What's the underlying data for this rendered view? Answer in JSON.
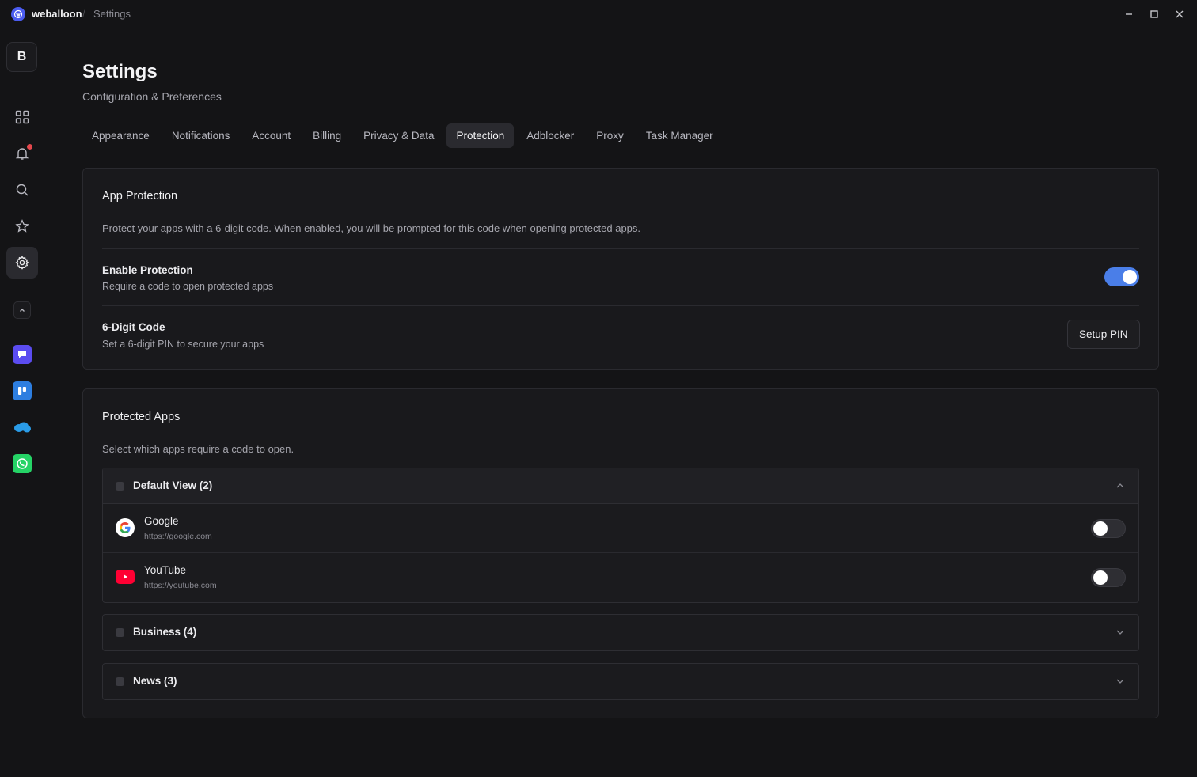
{
  "titlebar": {
    "app_name": "weballoon",
    "separator": "/",
    "page": "Settings",
    "controls": [
      "minimize-icon",
      "maximize-icon",
      "close-icon"
    ]
  },
  "sidebar": {
    "profile_initial": "B",
    "nav": [
      "grid-icon",
      "bell-icon",
      "search-icon",
      "star-icon",
      "gear-icon"
    ],
    "active": "gear-icon",
    "has_notification": true,
    "apps": [
      "chat-app-icon",
      "trello-icon",
      "salesforce-icon",
      "whatsapp-icon"
    ]
  },
  "header": {
    "title": "Settings",
    "subtitle": "Configuration & Preferences"
  },
  "tabs": [
    {
      "label": "Appearance",
      "active": false
    },
    {
      "label": "Notifications",
      "active": false
    },
    {
      "label": "Account",
      "active": false
    },
    {
      "label": "Billing",
      "active": false
    },
    {
      "label": "Privacy & Data",
      "active": false
    },
    {
      "label": "Protection",
      "active": true
    },
    {
      "label": "Adblocker",
      "active": false
    },
    {
      "label": "Proxy",
      "active": false
    },
    {
      "label": "Task Manager",
      "active": false
    }
  ],
  "app_protection": {
    "title": "App Protection",
    "description": "Protect your apps with a 6-digit code. When enabled, you will be prompted for this code when opening protected apps.",
    "enable": {
      "title": "Enable Protection",
      "description": "Require a code to open protected apps",
      "enabled": true
    },
    "pin": {
      "title": "6-Digit Code",
      "description": "Set a 6-digit PIN to secure your apps",
      "button_label": "Setup PIN"
    }
  },
  "protected_apps": {
    "title": "Protected Apps",
    "description": "Select which apps require a code to open.",
    "groups": [
      {
        "label": "Default View (2)",
        "expanded": true,
        "apps": [
          {
            "name": "Google",
            "url": "https://google.com",
            "icon": "google-icon",
            "protected": false
          },
          {
            "name": "YouTube",
            "url": "https://youtube.com",
            "icon": "youtube-icon",
            "protected": false
          }
        ]
      },
      {
        "label": "Business (4)",
        "expanded": false
      },
      {
        "label": "News (3)",
        "expanded": false
      }
    ]
  },
  "colors": {
    "background": "#141416",
    "card": "#19191c",
    "accent": "#4a7ee8",
    "notification": "#e5484d"
  }
}
